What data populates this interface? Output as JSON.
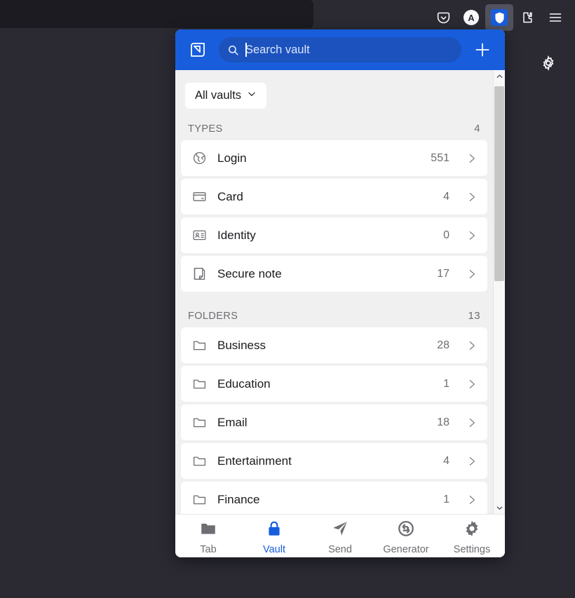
{
  "browser": {
    "toolbar_buttons": [
      {
        "name": "pocket-icon",
        "label": "Pocket"
      },
      {
        "name": "account-avatar",
        "label": "A"
      },
      {
        "name": "bitwarden-extension-icon",
        "label": "Bitwarden"
      },
      {
        "name": "extensions-icon",
        "label": "Extensions"
      },
      {
        "name": "app-menu-icon",
        "label": "Open application menu"
      }
    ],
    "page_gear_label": "Settings"
  },
  "popup": {
    "header": {
      "popout_label": "Pop out to new window",
      "add_label": "Add item",
      "search": {
        "value": "",
        "placeholder": "Search vault"
      }
    },
    "vault_filter": {
      "label": "All vaults"
    },
    "sections": [
      {
        "title": "TYPES",
        "count": "4",
        "items": [
          {
            "icon": "globe-icon",
            "label": "Login",
            "count": "551"
          },
          {
            "icon": "card-icon",
            "label": "Card",
            "count": "4"
          },
          {
            "icon": "identity-icon",
            "label": "Identity",
            "count": "0"
          },
          {
            "icon": "note-icon",
            "label": "Secure note",
            "count": "17"
          }
        ]
      },
      {
        "title": "FOLDERS",
        "count": "13",
        "items": [
          {
            "icon": "folder-icon",
            "label": "Business",
            "count": "28"
          },
          {
            "icon": "folder-icon",
            "label": "Education",
            "count": "1"
          },
          {
            "icon": "folder-icon",
            "label": "Email",
            "count": "18"
          },
          {
            "icon": "folder-icon",
            "label": "Entertainment",
            "count": "4"
          },
          {
            "icon": "folder-icon",
            "label": "Finance",
            "count": "1"
          }
        ]
      }
    ],
    "footer": {
      "items": [
        {
          "icon": "folder-icon",
          "label": "Tab",
          "active": false
        },
        {
          "icon": "lock-icon",
          "label": "Vault",
          "active": true
        },
        {
          "icon": "send-icon",
          "label": "Send",
          "active": false
        },
        {
          "icon": "generator-icon",
          "label": "Generator",
          "active": false
        },
        {
          "icon": "gear-icon",
          "label": "Settings",
          "active": false
        }
      ]
    }
  },
  "colors": {
    "brand_blue": "#175ddc",
    "search_blue": "#1b52bd",
    "chrome_dark": "#2b2a33",
    "urlbar_dark": "#1c1b22",
    "popup_bg": "#f0f0f0"
  }
}
